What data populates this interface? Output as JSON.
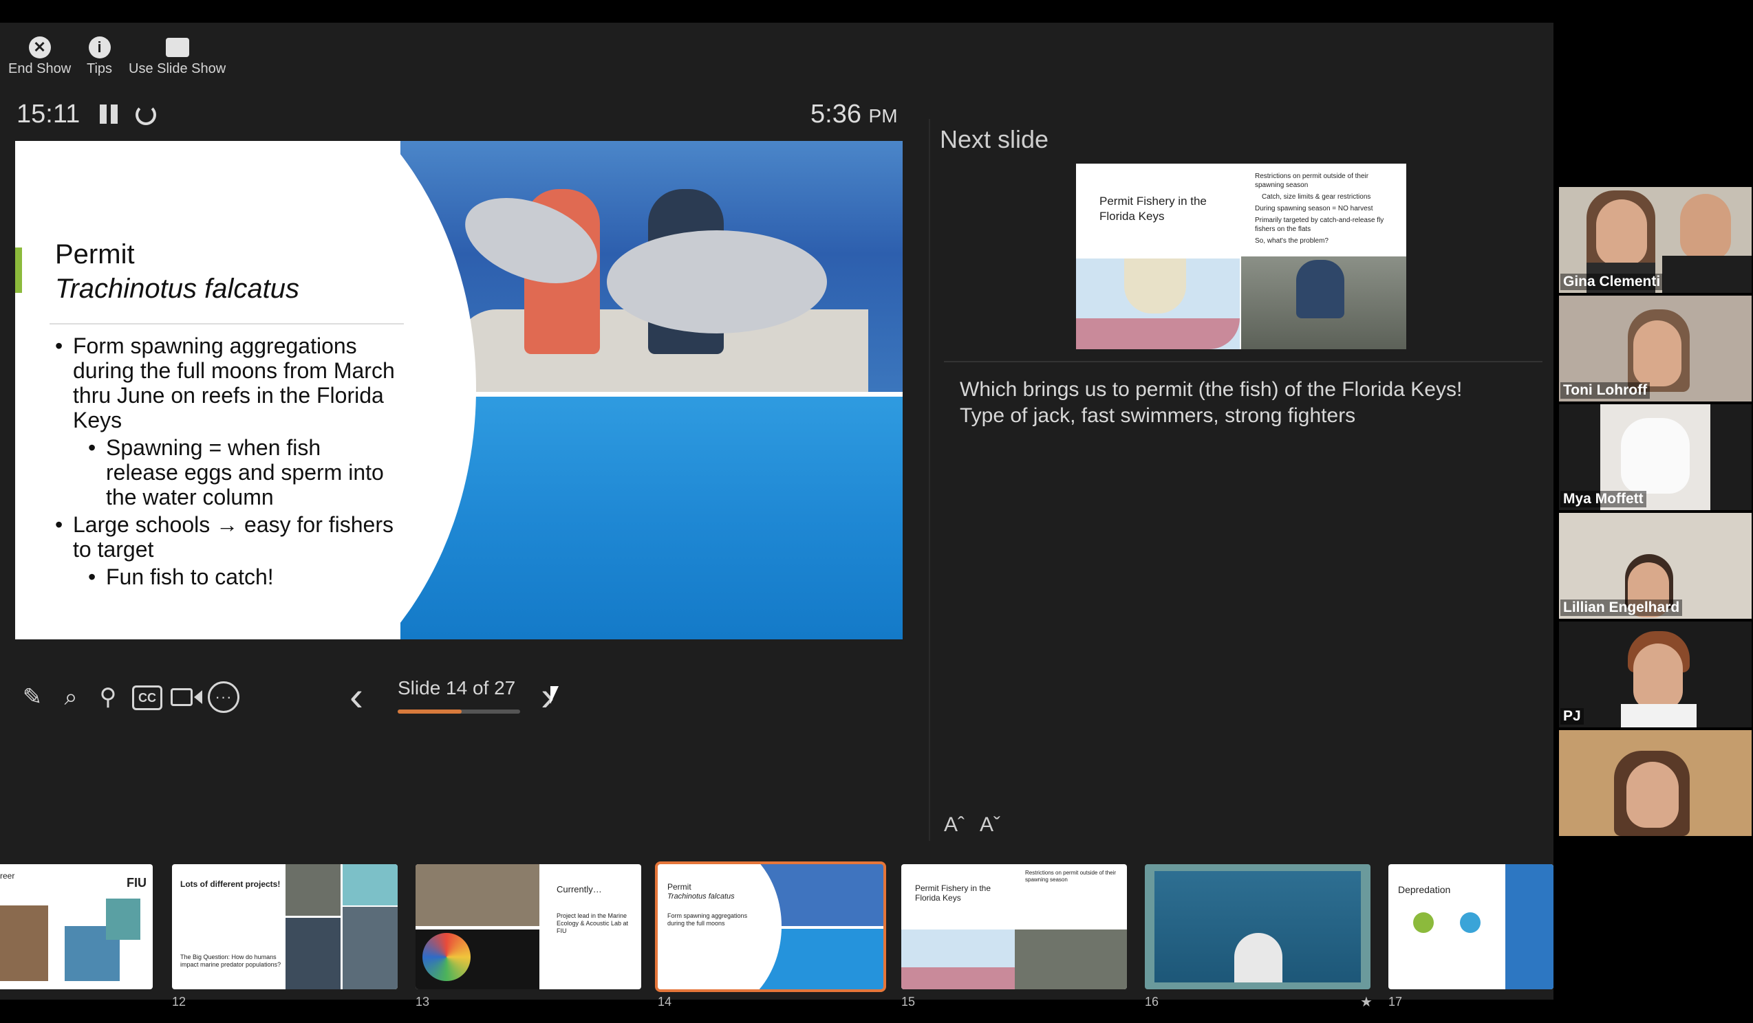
{
  "toolbar": {
    "end_show": "End Show",
    "tips": "Tips",
    "use_slide_show": "Use Slide Show"
  },
  "timer": "15:11",
  "clock": {
    "time": "5:36",
    "suffix": "PM"
  },
  "current_slide": {
    "title": "Permit",
    "subtitle": "Trachinotus falcatus",
    "bullets": [
      {
        "text": "Form spawning aggregations during the full moons from March thru June on reefs in the Florida Keys",
        "level": 1
      },
      {
        "text": "Spawning = when fish release eggs and sperm into the water column",
        "level": 2
      },
      {
        "text": "Large schools → easy for fishers to target",
        "level": 1
      },
      {
        "text": "Fun fish to catch!",
        "level": 2
      }
    ]
  },
  "navigation": {
    "counter": "Slide 14 of 27",
    "progress": 0.52
  },
  "next_slide": {
    "label": "Next slide",
    "title": "Permit Fishery in the Florida Keys",
    "bullets": [
      "Restrictions on permit outside of their spawning season",
      "Catch, size limits & gear restrictions",
      "During spawning season = NO harvest",
      "Primarily targeted by catch-and-release fly fishers on the flats",
      "So, what's the problem?"
    ]
  },
  "notes": {
    "line1": "Which brings us to permit (the fish) of the Florida Keys!",
    "line2": "Type of jack, fast swimmers, strong fighters"
  },
  "thumbnails": [
    {
      "num": "",
      "text": "reer",
      "extra": "FIU"
    },
    {
      "num": "12",
      "title": "Lots of different projects!",
      "text": "The Big Question: How do humans impact marine predator populations?"
    },
    {
      "num": "13",
      "title": "Currently…",
      "text": "Project lead in the Marine Ecology & Acoustic Lab at FIU"
    },
    {
      "num": "14",
      "title": "Permit",
      "subtitle": "Trachinotus falcatus",
      "text": "Form spawning aggregations during the full moons"
    },
    {
      "num": "15",
      "title": "Permit Fishery in the Florida Keys",
      "text": "Restrictions on permit outside of their spawning season"
    },
    {
      "num": "16",
      "title": "",
      "text": ""
    },
    {
      "num": "17",
      "title": "Depredation",
      "text": ""
    }
  ],
  "participants": [
    {
      "name": "Gina Clementi"
    },
    {
      "name": "Toni Lohroff"
    },
    {
      "name": "Mya Moffett"
    },
    {
      "name": "Lillian Engelhard"
    },
    {
      "name": "PJ"
    },
    {
      "name": ""
    }
  ],
  "colors": {
    "accent": "#e5763a",
    "progress": "#d87a3c",
    "slide_accent": "#8cba3c",
    "background": "#1e1e1e"
  }
}
